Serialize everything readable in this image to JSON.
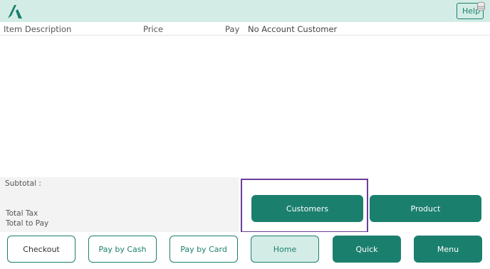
{
  "topbar": {
    "logo_icon": "app-logo-icon",
    "help_label": "Help",
    "help_icon": "coin-stack-icon"
  },
  "header": {
    "item_description": "Item Description",
    "price": "Price",
    "pay": "Pay",
    "customer": "No Account Customer"
  },
  "totals": {
    "subtotal_label": "Subtotal :",
    "total_tax_label": "Total Tax",
    "total_to_pay_label": "Total to Pay"
  },
  "actions": {
    "customers": "Customers",
    "product": "Product",
    "checkout": "Checkout",
    "pay_by_cash": "Pay by Cash",
    "pay_by_card": "Pay by Card",
    "home": "Home",
    "quick": "Quick",
    "menu": "Menu"
  },
  "colors": {
    "accent": "#1b7f6e",
    "accent_light": "#d3ede6",
    "highlight": "#6a3d9a"
  }
}
